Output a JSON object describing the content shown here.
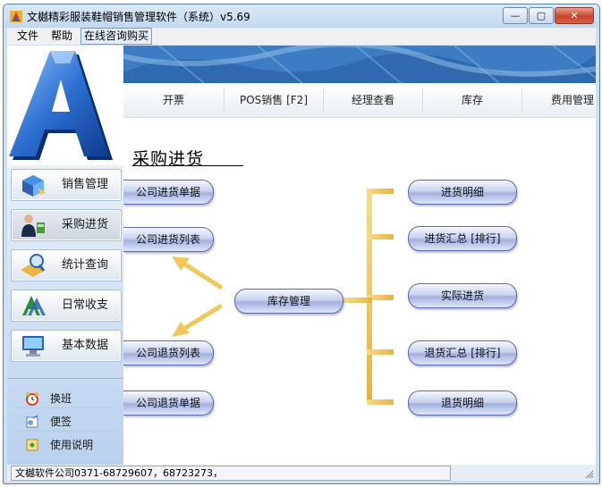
{
  "window": {
    "title": "文樾精彩服装鞋帽销售管理软件（系统）v5.69",
    "buttons": {
      "minimize": "—",
      "maximize": "▢",
      "close": "✕"
    }
  },
  "menubar": [
    "文件",
    "帮助",
    "在线咨询购买"
  ],
  "logo": {
    "letter": "A"
  },
  "sidebar": {
    "nav": [
      {
        "label": "销售管理",
        "icon": "sales-icon"
      },
      {
        "label": "采购进货",
        "icon": "purchase-icon"
      },
      {
        "label": "统计查询",
        "icon": "statistics-icon"
      },
      {
        "label": "日常收支",
        "icon": "daily-finance-icon"
      },
      {
        "label": "基本数据",
        "icon": "basic-data-icon"
      }
    ],
    "utilities": [
      {
        "label": "换班",
        "icon": "alarm-clock-icon"
      },
      {
        "label": "便签",
        "icon": "note-icon"
      },
      {
        "label": "使用说明",
        "icon": "help-icon"
      }
    ]
  },
  "topnav": [
    "开票",
    "POS销售 [F2]",
    "经理查看",
    "库存",
    "费用管理"
  ],
  "page": {
    "title": "采购进货",
    "left_buttons": [
      "公司进货单据",
      "公司进货列表",
      "公司退货列表",
      "公司退货单据"
    ],
    "center_button": "库存管理",
    "right_buttons": [
      "进货明细",
      "进货汇总 [排行]",
      "实际进货",
      "退货汇总 [排行]",
      "退货明细"
    ]
  },
  "colors": {
    "accent": "#5d6aa8",
    "connector": "#f0c85a",
    "banner": "#3a7ac0"
  },
  "status": {
    "text": "文樾软件公司0371-68729607，68723273，"
  }
}
